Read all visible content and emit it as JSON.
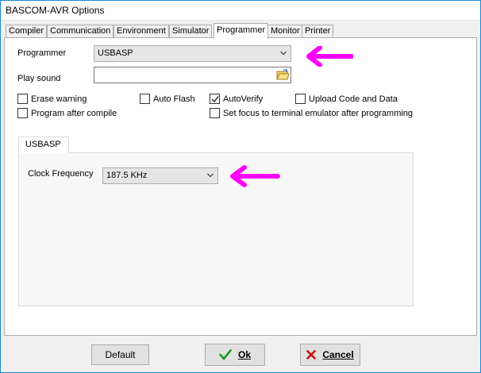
{
  "window": {
    "title": "BASCOM-AVR Options"
  },
  "tabs": [
    {
      "label": "Compiler"
    },
    {
      "label": "Communication"
    },
    {
      "label": "Environment"
    },
    {
      "label": "Simulator"
    },
    {
      "label": "Programmer"
    },
    {
      "label": "Monitor"
    },
    {
      "label": "Printer"
    }
  ],
  "active_tab": "Programmer",
  "programmer": {
    "label": "Programmer",
    "value": "USBASP",
    "play_sound_label": "Play sound",
    "play_sound_value": ""
  },
  "checkboxes": {
    "erase_warning": {
      "label": "Erase warning",
      "checked": false
    },
    "auto_flash": {
      "label": "Auto Flash",
      "checked": false
    },
    "auto_verify": {
      "label": "AutoVerify",
      "checked": true
    },
    "upload_code_data": {
      "label": "Upload Code and Data",
      "checked": false
    },
    "program_after_compile": {
      "label": "Program after compile",
      "checked": false
    },
    "set_focus": {
      "label": "Set focus to terminal emulator after programming",
      "checked": false
    }
  },
  "usbasp": {
    "tab_label": "USBASP",
    "clock_label": "Clock Frequency",
    "clock_value": "187.5 KHz"
  },
  "buttons": {
    "default": "Default",
    "ok": "Ok",
    "cancel": "Cancel"
  },
  "colors": {
    "highlight_arrow": "#ff00ff",
    "ok_icon": "#1a9a1a",
    "cancel_icon": "#d01010",
    "window_border": "#1a8ad6"
  }
}
